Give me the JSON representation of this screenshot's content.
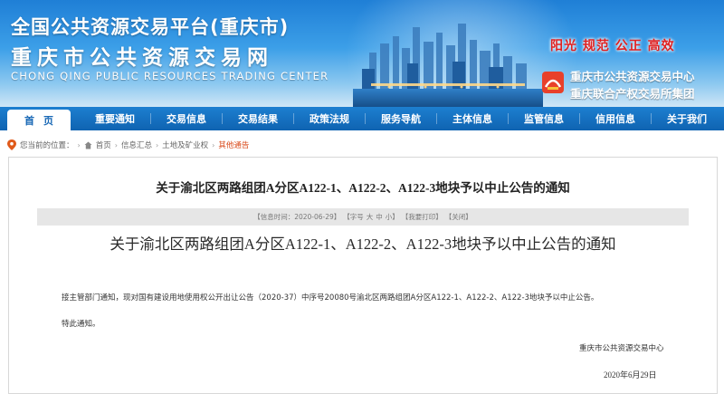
{
  "header": {
    "title_line1": "全国公共资源交易平台(重庆市)",
    "title_line2": "重庆市公共资源交易网",
    "title_en": "CHONG QING PUBLIC RESOURCES TRADING CENTER",
    "slogan": "阳光  规范  公正  高效",
    "org_line1": "重庆市公共资源交易中心",
    "org_line2": "重庆联合产权交易所集团",
    "colors": {
      "banner": "#2a8be0",
      "nav": "#1767b5",
      "slogan": "#e02020"
    }
  },
  "nav": {
    "items": [
      "首页",
      "重要通知",
      "交易信息",
      "交易结果",
      "政策法规",
      "服务导航",
      "主体信息",
      "监管信息",
      "信用信息",
      "关于我们"
    ]
  },
  "breadcrumb": {
    "prefix": "您当前的位置：",
    "items": [
      "首页",
      "信息汇总",
      "土地及矿业权",
      "其他通告"
    ]
  },
  "article": {
    "title": "关于渝北区两路组团A分区A122-1、A122-2、A122-3地块予以中止公告的通知",
    "info": {
      "time_label": "【信息时间：2020-06-29】",
      "font_label": "【字号",
      "font_big": "大",
      "font_mid": "中",
      "font_small": "小】",
      "print": "【我要打印】",
      "close": "【关闭】"
    },
    "body_title": "关于渝北区两路组团A分区A122-1、A122-2、A122-3地块予以中止公告的通知",
    "paragraph": "接主管部门通知，现对国有建设用地使用权公开出让公告（2020-37）中序号20080号渝北区两路组团A分区A122-1、A122-2、A122-3地块予以中止公告。",
    "closing": "特此通知。",
    "signature": "重庆市公共资源交易中心",
    "date": "2020年6月29日"
  }
}
